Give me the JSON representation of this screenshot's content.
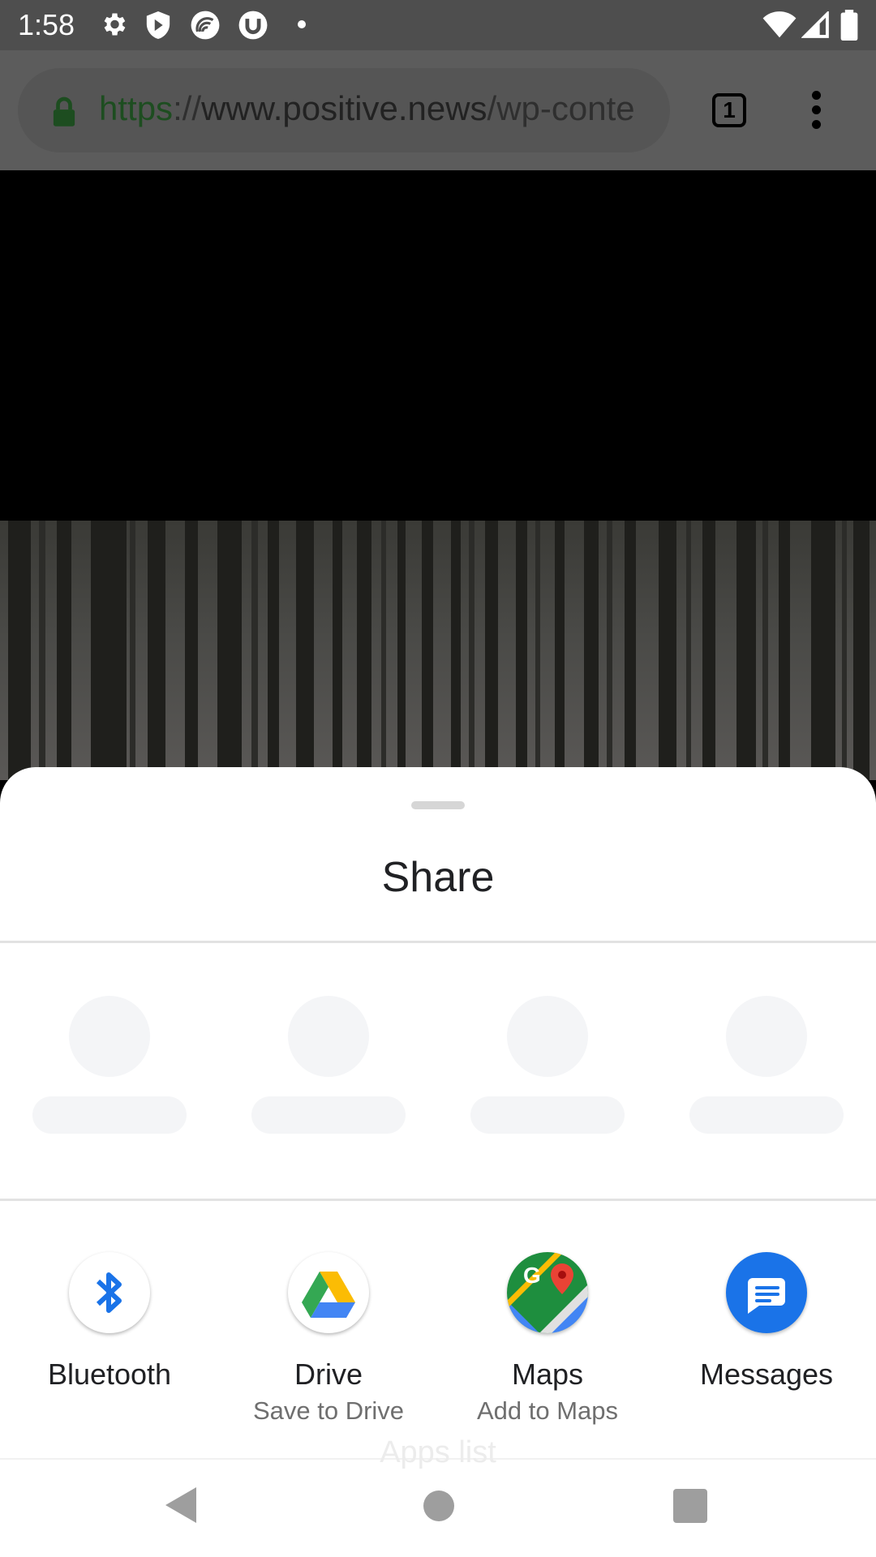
{
  "status_bar": {
    "time": "1:58",
    "icons": [
      "settings-icon",
      "shield-icon",
      "wifi-calling-icon",
      "torrent-icon",
      "notification-dot-icon"
    ],
    "right_icons": [
      "wifi-icon",
      "cell-signal-icon",
      "battery-icon"
    ]
  },
  "browser": {
    "url_scheme": "https",
    "url_sep": "://",
    "url_host": "www.positive.news",
    "url_path": "/wp-conte",
    "tab_count": "1"
  },
  "share_sheet": {
    "title": "Share",
    "apps": [
      {
        "label": "Bluetooth",
        "sub": "",
        "icon": "bluetooth-icon"
      },
      {
        "label": "Drive",
        "sub": "Save to Drive",
        "icon": "google-drive-icon"
      },
      {
        "label": "Maps",
        "sub": "Add to Maps",
        "icon": "google-maps-icon"
      },
      {
        "label": "Messages",
        "sub": "",
        "icon": "messages-icon"
      }
    ],
    "apps_list_label": "Apps list"
  },
  "colors": {
    "accent_blue": "#1a73e8",
    "messages_blue": "#1a73e8",
    "sheet_bg": "#ffffff",
    "scrim": "#4e4e4e"
  }
}
